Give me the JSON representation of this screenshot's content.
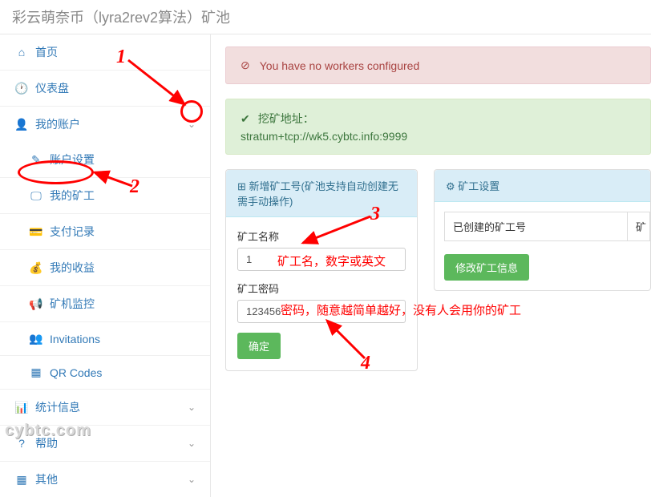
{
  "pageTitle": "彩云萌奈币（lyra2rev2算法）矿池",
  "sidebar": {
    "home": "首页",
    "dashboard": "仪表盘",
    "myAccount": "我的账户",
    "accountSettings": "账户设置",
    "myMiners": "我的矿工",
    "payRecords": "支付记录",
    "myEarnings": "我的收益",
    "minerMonitor": "矿机监控",
    "invitations": "Invitations",
    "qrCodes": "QR Codes",
    "stats": "统计信息",
    "help": "帮助",
    "other": "其他"
  },
  "alerts": {
    "noWorkers": "You have no workers configured",
    "miningAddrLabel": "挖矿地址：",
    "miningAddr": "stratum+tcp://wk5.cybtc.info:9999"
  },
  "createPanel": {
    "title": "新增矿工号(矿池支持自动创建无需手动操作)",
    "nameLabel": "矿工名称",
    "nameValue": "1",
    "pwdLabel": "矿工密码",
    "pwdValue": "123456",
    "submit": "确定"
  },
  "settingsPanel": {
    "title": "矿工设置",
    "colCreated": "已创建的矿工号",
    "colShort": "矿",
    "modifyBtn": "修改矿工信息"
  },
  "annotations": {
    "n1": "1",
    "n2": "2",
    "n3": "3",
    "n4": "4",
    "hintName": "矿工名，数字或英文",
    "hintPwd": "密码，随意越简单越好，没有人会用你的矿工"
  },
  "watermark": "cybtc.com"
}
